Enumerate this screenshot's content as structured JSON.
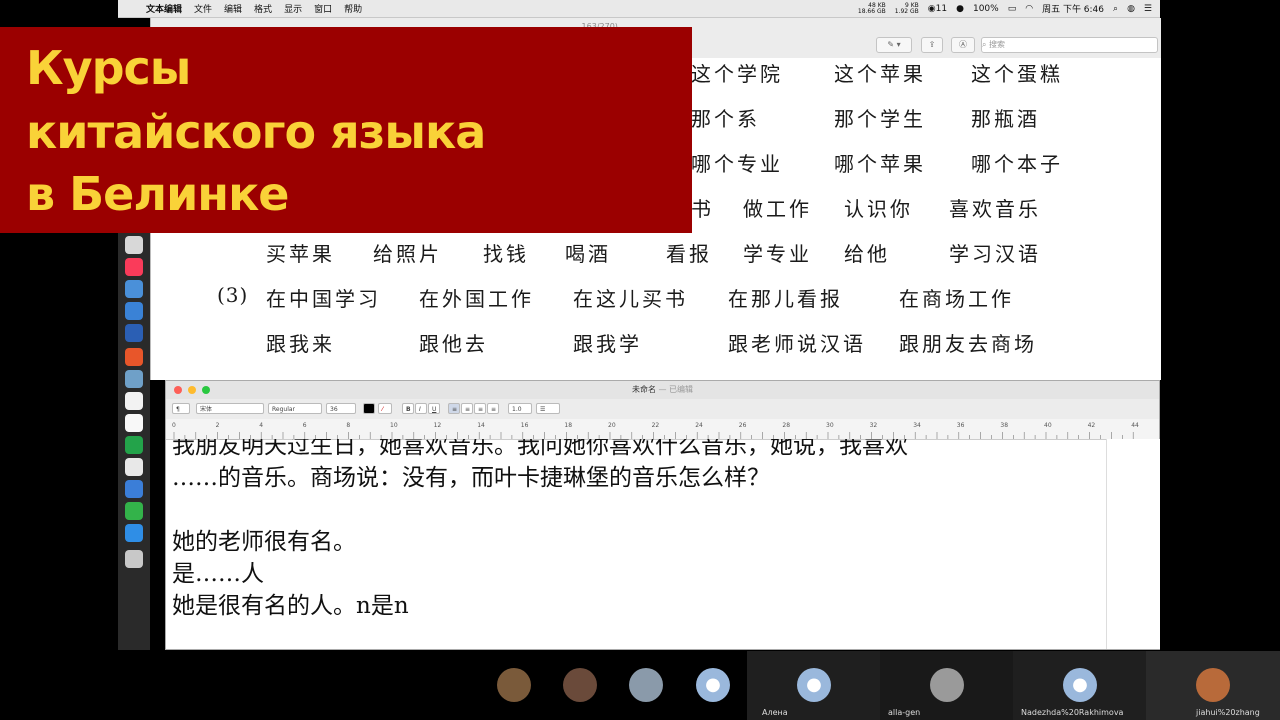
{
  "menubar": {
    "apple": "",
    "items": [
      "文本编辑",
      "文件",
      "编辑",
      "格式",
      "显示",
      "窗口",
      "帮助"
    ],
    "net_up": "48 KB",
    "net_up2": "18.66 GB",
    "net_down": "9 KB",
    "net_down2": "1.92 GB",
    "notification_count": "11",
    "battery": "100%",
    "clock": "周五 下午 6:46"
  },
  "pdf": {
    "title": "… 163/270)",
    "search_placeholder": "搜索",
    "rows": [
      [
        "这个学院",
        "这个苹果",
        "这个蛋糕"
      ],
      [
        "那个系",
        "那个学生",
        "那瓶酒"
      ],
      [
        "哪个专业",
        "哪个苹果",
        "哪个本子"
      ],
      [
        "书",
        "做工作",
        "认识你",
        "喜欢音乐"
      ],
      [
        "买苹果",
        "给照片",
        "找钱",
        "喝酒",
        "看报",
        "学专业",
        "给他",
        "学习汉语"
      ],
      [
        "(3)",
        "在中国学习",
        "在外国工作",
        "在这儿买书",
        "在那儿看报",
        "在商场工作"
      ],
      [
        "跟我来",
        "跟他去",
        "跟我学",
        "跟老师说汉语",
        "跟朋友去商场"
      ]
    ]
  },
  "banner": {
    "line1": "Курсы",
    "line2": "китайского языка",
    "line3": "в Белинке"
  },
  "textedit": {
    "title": "未命名",
    "subtitle": "— 已编辑",
    "paragraph_style": "¶",
    "font_name": "宋体",
    "font_style": "Regular",
    "font_size": "36",
    "line_spacing": "1.0",
    "ruler_numbers": [
      "0",
      "2",
      "4",
      "6",
      "8",
      "10",
      "12",
      "14",
      "16",
      "18",
      "20",
      "22",
      "24",
      "26",
      "28",
      "30",
      "32",
      "34",
      "36",
      "38",
      "40",
      "42",
      "44"
    ],
    "lines": [
      "我朋友明天过生日，她喜欢音乐。我问她你喜欢什么音乐，她说，我喜欢",
      "……的音乐。商场说：没有，而叶卡捷琳堡的音乐怎么样？",
      "",
      "她的老师很有名。",
      "是……人",
      "她是很有名的人。n是n"
    ]
  },
  "participants": [
    {
      "name": ""
    },
    {
      "name": ""
    },
    {
      "name": ""
    },
    {
      "name": ""
    },
    {
      "name": "Алена"
    },
    {
      "name": "alla-gen"
    },
    {
      "name": "Nadezhda%20Rakhimova"
    },
    {
      "name": "jiahui%20zhang"
    }
  ]
}
